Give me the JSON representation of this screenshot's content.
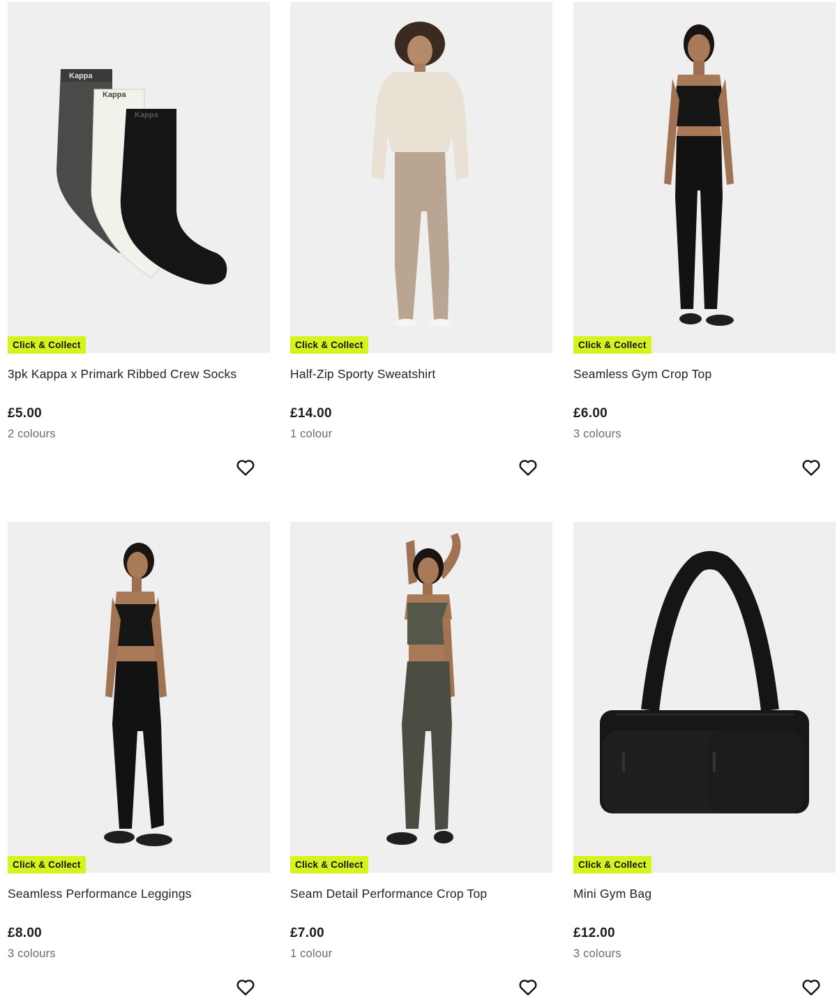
{
  "products": [
    {
      "title": "3pk Kappa x Primark Ribbed Crew Socks",
      "price": "£5.00",
      "colours": "2 colours",
      "badge": "Click & Collect",
      "sock_brand": "Kappa",
      "image_icon": "socks-image"
    },
    {
      "title": "Half-Zip Sporty Sweatshirt",
      "price": "£14.00",
      "colours": "1 colour",
      "badge": "Click & Collect",
      "image_icon": "model-sweatshirt-image"
    },
    {
      "title": "Seamless Gym Crop Top",
      "price": "£6.00",
      "colours": "3 colours",
      "badge": "Click & Collect",
      "image_icon": "model-crop-top-image"
    },
    {
      "title": "Seamless Performance Leggings",
      "price": "£8.00",
      "colours": "3 colours",
      "badge": "Click & Collect",
      "image_icon": "model-leggings-image"
    },
    {
      "title": "Seam Detail Performance Crop Top",
      "price": "£7.00",
      "colours": "1 colour",
      "badge": "Click & Collect",
      "image_icon": "model-seam-crop-top-image"
    },
    {
      "title": "Mini Gym Bag",
      "price": "£12.00",
      "colours": "3 colours",
      "badge": "Click & Collect",
      "image_icon": "gym-bag-image"
    }
  ],
  "theme": {
    "badge_color": "#d6f31d",
    "image_bg": "#efefef"
  }
}
